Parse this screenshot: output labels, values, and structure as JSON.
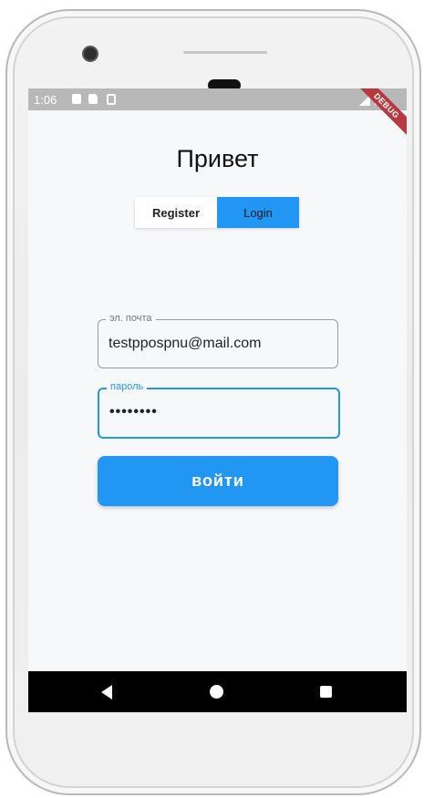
{
  "status_bar": {
    "time": "1:06",
    "debug_label": "DEBUG"
  },
  "screen": {
    "title": "Привет",
    "tabs": [
      {
        "label": "Register",
        "active": false
      },
      {
        "label": "Login",
        "active": true
      }
    ],
    "email_field": {
      "label": "эл. почта",
      "value": "testpposрnu@mail.com"
    },
    "password_field": {
      "label": "пароль",
      "value": "••••••••"
    },
    "submit_label": "войти"
  },
  "colors": {
    "accent": "#2196f3",
    "debug_banner": "#b8383f",
    "status_bar": "#b8b8b8",
    "nav_bar": "#000000"
  },
  "icons": {
    "status": [
      "notification-a-icon",
      "sd-card-icon",
      "storage-icon",
      "signal-icon",
      "battery-icon"
    ],
    "nav": [
      "back-icon",
      "home-icon",
      "recents-icon"
    ]
  }
}
